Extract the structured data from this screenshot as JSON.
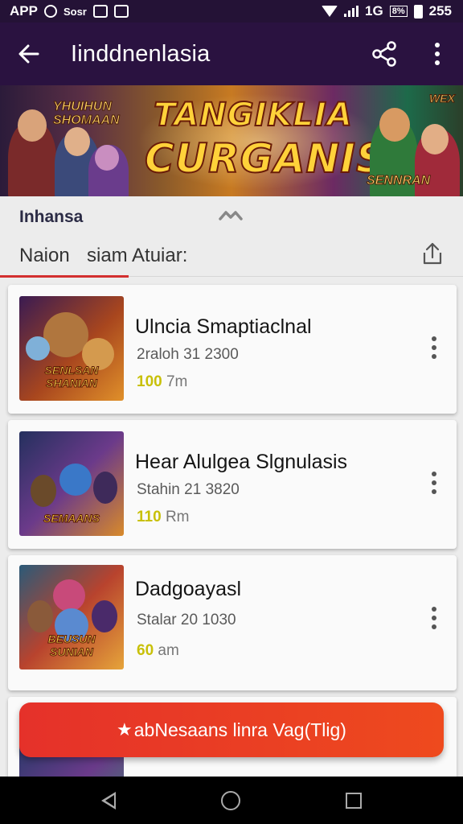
{
  "status_bar": {
    "left_text": "APP",
    "left_extra": "Sosr",
    "network": "1G",
    "battery_label": "8%",
    "time": "255"
  },
  "app_bar": {
    "title": "Iinddnenlasia"
  },
  "banner": {
    "title_line1": "TANGIKLIA",
    "title_line2": "CURGANIS",
    "left_tag": "YHUIHUN SHOMAAN",
    "right_tag": "SENNRAN",
    "corner_tag": "WEX"
  },
  "section": {
    "title": "Inhansa",
    "tabs": [
      "Naion",
      "siam Atuiar:"
    ]
  },
  "cards": [
    {
      "title": "Ulncia Smaptiaclnal",
      "subtitle": "2raloh 31 2300",
      "meta_value": "100",
      "meta_unit": "7m",
      "thumb_label": "SENLSAN SHANIAN",
      "thumb_colors": [
        "#3a1b52",
        "#a8461e",
        "#e0902a"
      ]
    },
    {
      "title": "Hear Alulgea Slgnulasis",
      "subtitle": "Stahin 21 3820",
      "meta_value": "110",
      "meta_unit": "Rm",
      "thumb_label": "SEMAANS",
      "thumb_colors": [
        "#24305e",
        "#6b3a8a",
        "#d88a2a"
      ]
    },
    {
      "title": "Dadgoayasl",
      "subtitle": "Stalar 20 1030",
      "meta_value": "60",
      "meta_unit": "am",
      "thumb_label": "BEUSUN SUNIAN",
      "thumb_colors": [
        "#2b5a78",
        "#b8432e",
        "#e6a43a"
      ]
    }
  ],
  "cta": {
    "star": "★",
    "label": "abNesaans linra Vag(Tlig)"
  },
  "colors": {
    "app_bar": "#2a1240",
    "accent_red": "#d32f2f",
    "cta_start": "#e5312a",
    "cta_end": "#ee4a1e",
    "meta_highlight": "#c8c008"
  }
}
